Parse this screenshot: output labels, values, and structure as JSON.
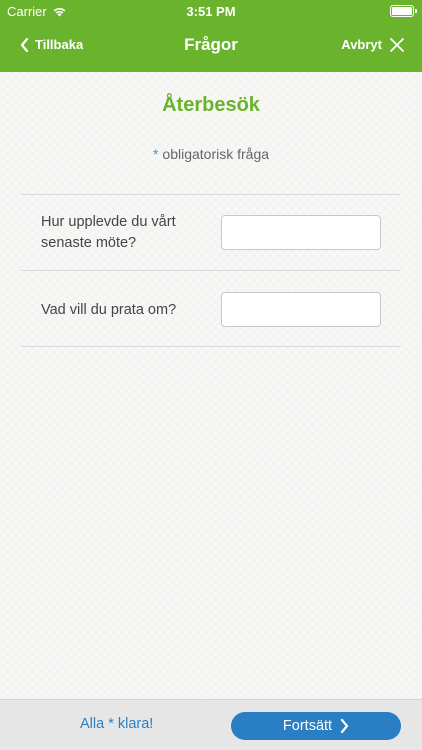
{
  "status_bar": {
    "carrier": "Carrier",
    "time": "3:51 PM",
    "wifi_icon": "wifi-icon",
    "battery_icon": "battery-icon"
  },
  "nav": {
    "back_label": "Tillbaka",
    "title": "Frågor",
    "cancel_label": "Avbryt",
    "color": "#6ab42d"
  },
  "form": {
    "title": "Återbesök",
    "required_star": "*",
    "required_note": "obligatorisk fråga",
    "questions": [
      {
        "label": "Hur upplevde du vårt senaste möte?",
        "value": "",
        "placeholder": ""
      },
      {
        "label": "Vad vill du prata om?",
        "value": "",
        "placeholder": ""
      }
    ]
  },
  "bottom": {
    "all_done_label": "Alla * klara!",
    "continue_label": "Fortsätt",
    "continue_color": "#2a7fc4"
  }
}
